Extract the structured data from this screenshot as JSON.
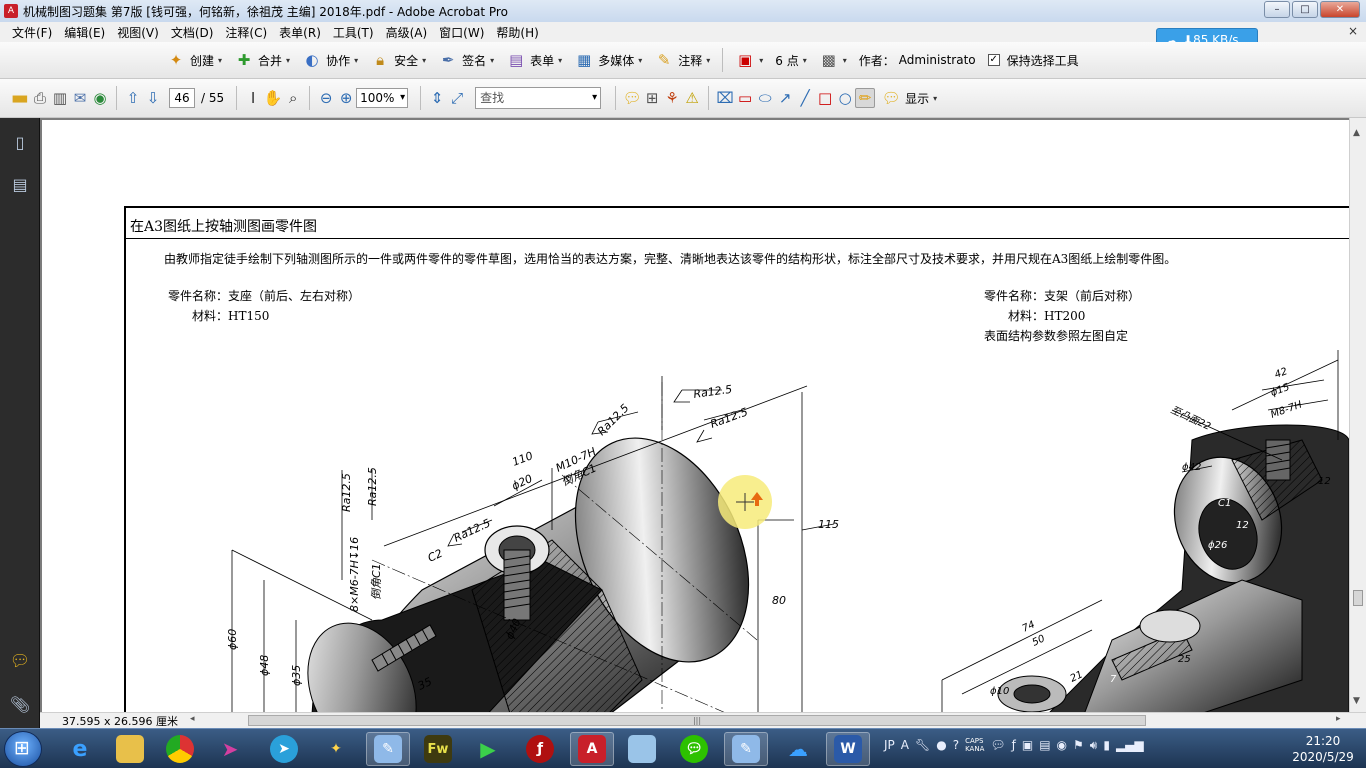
{
  "window": {
    "title": "机械制图习题集 第7版 [钱可强，何铭新，徐祖茂 主编] 2018年.pdf - Adobe Acrobat Pro",
    "controls": [
      "–",
      "□",
      "✕"
    ]
  },
  "menu": [
    "文件(F)",
    "编辑(E)",
    "视图(V)",
    "文档(D)",
    "注释(C)",
    "表单(R)",
    "工具(T)",
    "高级(A)",
    "窗口(W)",
    "帮助(H)"
  ],
  "menu_close": "×",
  "toolbar1": {
    "create": "创建",
    "combine": "合并",
    "collaborate": "协作",
    "secure": "安全",
    "sign": "签名",
    "forms": "表单",
    "multimedia": "多媒体",
    "comment": "注释",
    "line_weight": "6 点",
    "author_label": "作者：",
    "author_value": "Administrato",
    "keep_tool": "保持选择工具"
  },
  "toolbar2": {
    "page_current": "46",
    "page_total": "/ 55",
    "zoom": "100%",
    "find_placeholder": "查找",
    "show": "显示"
  },
  "speed_widget": {
    "value": "85 KB/s"
  },
  "document": {
    "frame_title": "在A3图纸上按轴测图画零件图",
    "instruction": "由教师指定徒手绘制下列轴测图所示的一件或两件零件的零件草图，选用恰当的表达方案，完整、清晰地表达该零件的结构形状，标注全部尺寸及技术要求，并用尺规在A3图纸上绘制零件图。",
    "part_left": {
      "name": "零件名称：支座（前后、左右对称）",
      "material": "材料：HT150"
    },
    "part_right": {
      "name": "零件名称：支架（前后对称）",
      "material": "材料：HT200",
      "note": "表面结构参数参照左图自定"
    },
    "dims_left": [
      "110",
      "Ra12.5",
      "Ra12.5",
      "M10-7H",
      "倒角C1",
      "Ra12.5",
      "ϕ20",
      "C2",
      "Ra12.5",
      "Ra12.5",
      "Ra12.5",
      "8×M6-7H↧16",
      "倒角C1",
      "ϕ60",
      "ϕ48",
      "ϕ35",
      "ϕ40",
      "35",
      "115",
      "80"
    ],
    "dims_right": [
      "42",
      "ϕ15",
      "M8-7H",
      "至凸面22",
      "ϕ42",
      "C1",
      "12",
      "12",
      "ϕ26",
      "74",
      "50",
      "21",
      "7",
      "25",
      "ϕ10"
    ]
  },
  "status": {
    "dimensions": "37.595 x 26.596 厘米"
  },
  "taskbar": {
    "apps": [
      "IE",
      "Explorer",
      "Chrome",
      "Send",
      "Telegram",
      "Kingsoft",
      "Paint",
      "Fw",
      "Player",
      "Flash",
      "Acrobat",
      "Doc",
      "WeChat",
      "Paint",
      "Baidu",
      "Word"
    ],
    "tray_lang": "JP",
    "caps": "CAPS",
    "kana": "KANA",
    "time": "21:20",
    "date": "2020/5/29"
  }
}
